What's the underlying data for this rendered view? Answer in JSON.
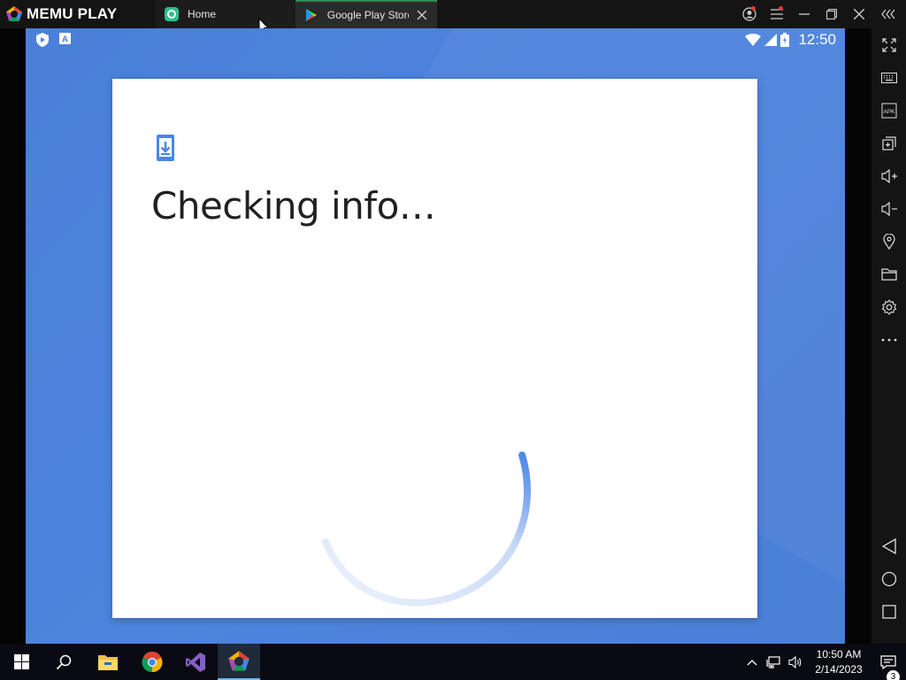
{
  "app": {
    "brand": "MEMU PLAY"
  },
  "tabs": [
    {
      "label": "Home"
    },
    {
      "label": "Google Play Store"
    }
  ],
  "android": {
    "clock": "12:50",
    "dialog": {
      "title": "Checking info…"
    }
  },
  "taskbar": {
    "time": "10:50 AM",
    "date": "2/14/2023",
    "notification_count": "3"
  },
  "colors": {
    "android_bg": "#4a80d8",
    "accent_blue": "#4a86e8",
    "tab_active_border": "#2e8b57"
  },
  "icons": {
    "titlebar": [
      "memu-logo-icon",
      "home-tab-icon",
      "play-store-icon",
      "close-icon",
      "account-icon",
      "menu-icon",
      "minimize-icon",
      "restore-icon",
      "window-close-icon",
      "collapse-sidebar-icon"
    ],
    "sidebar": [
      "fullscreen-icon",
      "keyboard-icon",
      "apk-icon",
      "multi-instance-icon",
      "volume-up-icon",
      "volume-down-icon",
      "location-icon",
      "folder-icon",
      "settings-icon",
      "more-icon",
      "back-icon",
      "home-icon",
      "recents-icon"
    ],
    "taskbar": [
      "windows-start-icon",
      "search-icon",
      "file-explorer-icon",
      "chrome-icon",
      "visual-studio-icon",
      "memu-app-icon",
      "chevron-up-icon",
      "network-icon",
      "volume-icon",
      "notification-icon"
    ]
  }
}
